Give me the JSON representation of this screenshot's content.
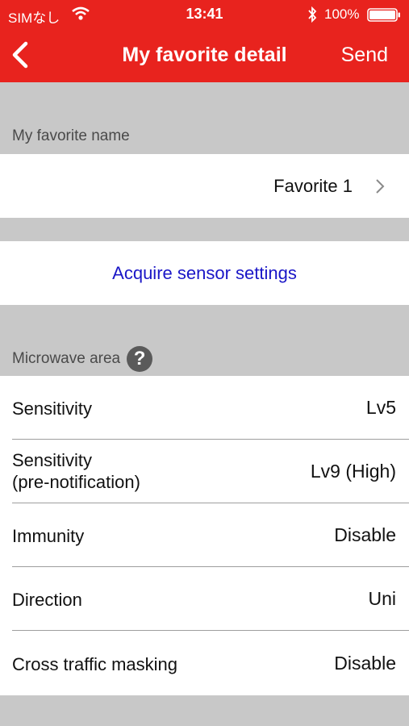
{
  "status_bar": {
    "carrier": "SIMなし",
    "time": "13:41",
    "battery_pct": "100%",
    "battery_level": 1.0
  },
  "nav": {
    "title": "My favorite detail",
    "send_label": "Send",
    "back_icon": "chevron-left-icon"
  },
  "favorite_section": {
    "header": "My favorite name",
    "value": "Favorite 1"
  },
  "acquire": {
    "label": "Acquire sensor settings"
  },
  "microwave_section": {
    "header": "Microwave area",
    "help_icon": "?",
    "rows": [
      {
        "label": "Sensitivity",
        "value": "Lv5"
      },
      {
        "label": "Sensitivity",
        "label2": "(pre-notification)",
        "value": "Lv9 (High)"
      },
      {
        "label": "Immunity",
        "value": "Disable"
      },
      {
        "label": "Direction",
        "value": "Uni"
      },
      {
        "label": "Cross traffic masking",
        "value": "Disable"
      }
    ]
  },
  "colors": {
    "nav_bg": "#e8231e",
    "group_bg": "#c8c8c8",
    "link": "#1a16c7"
  }
}
